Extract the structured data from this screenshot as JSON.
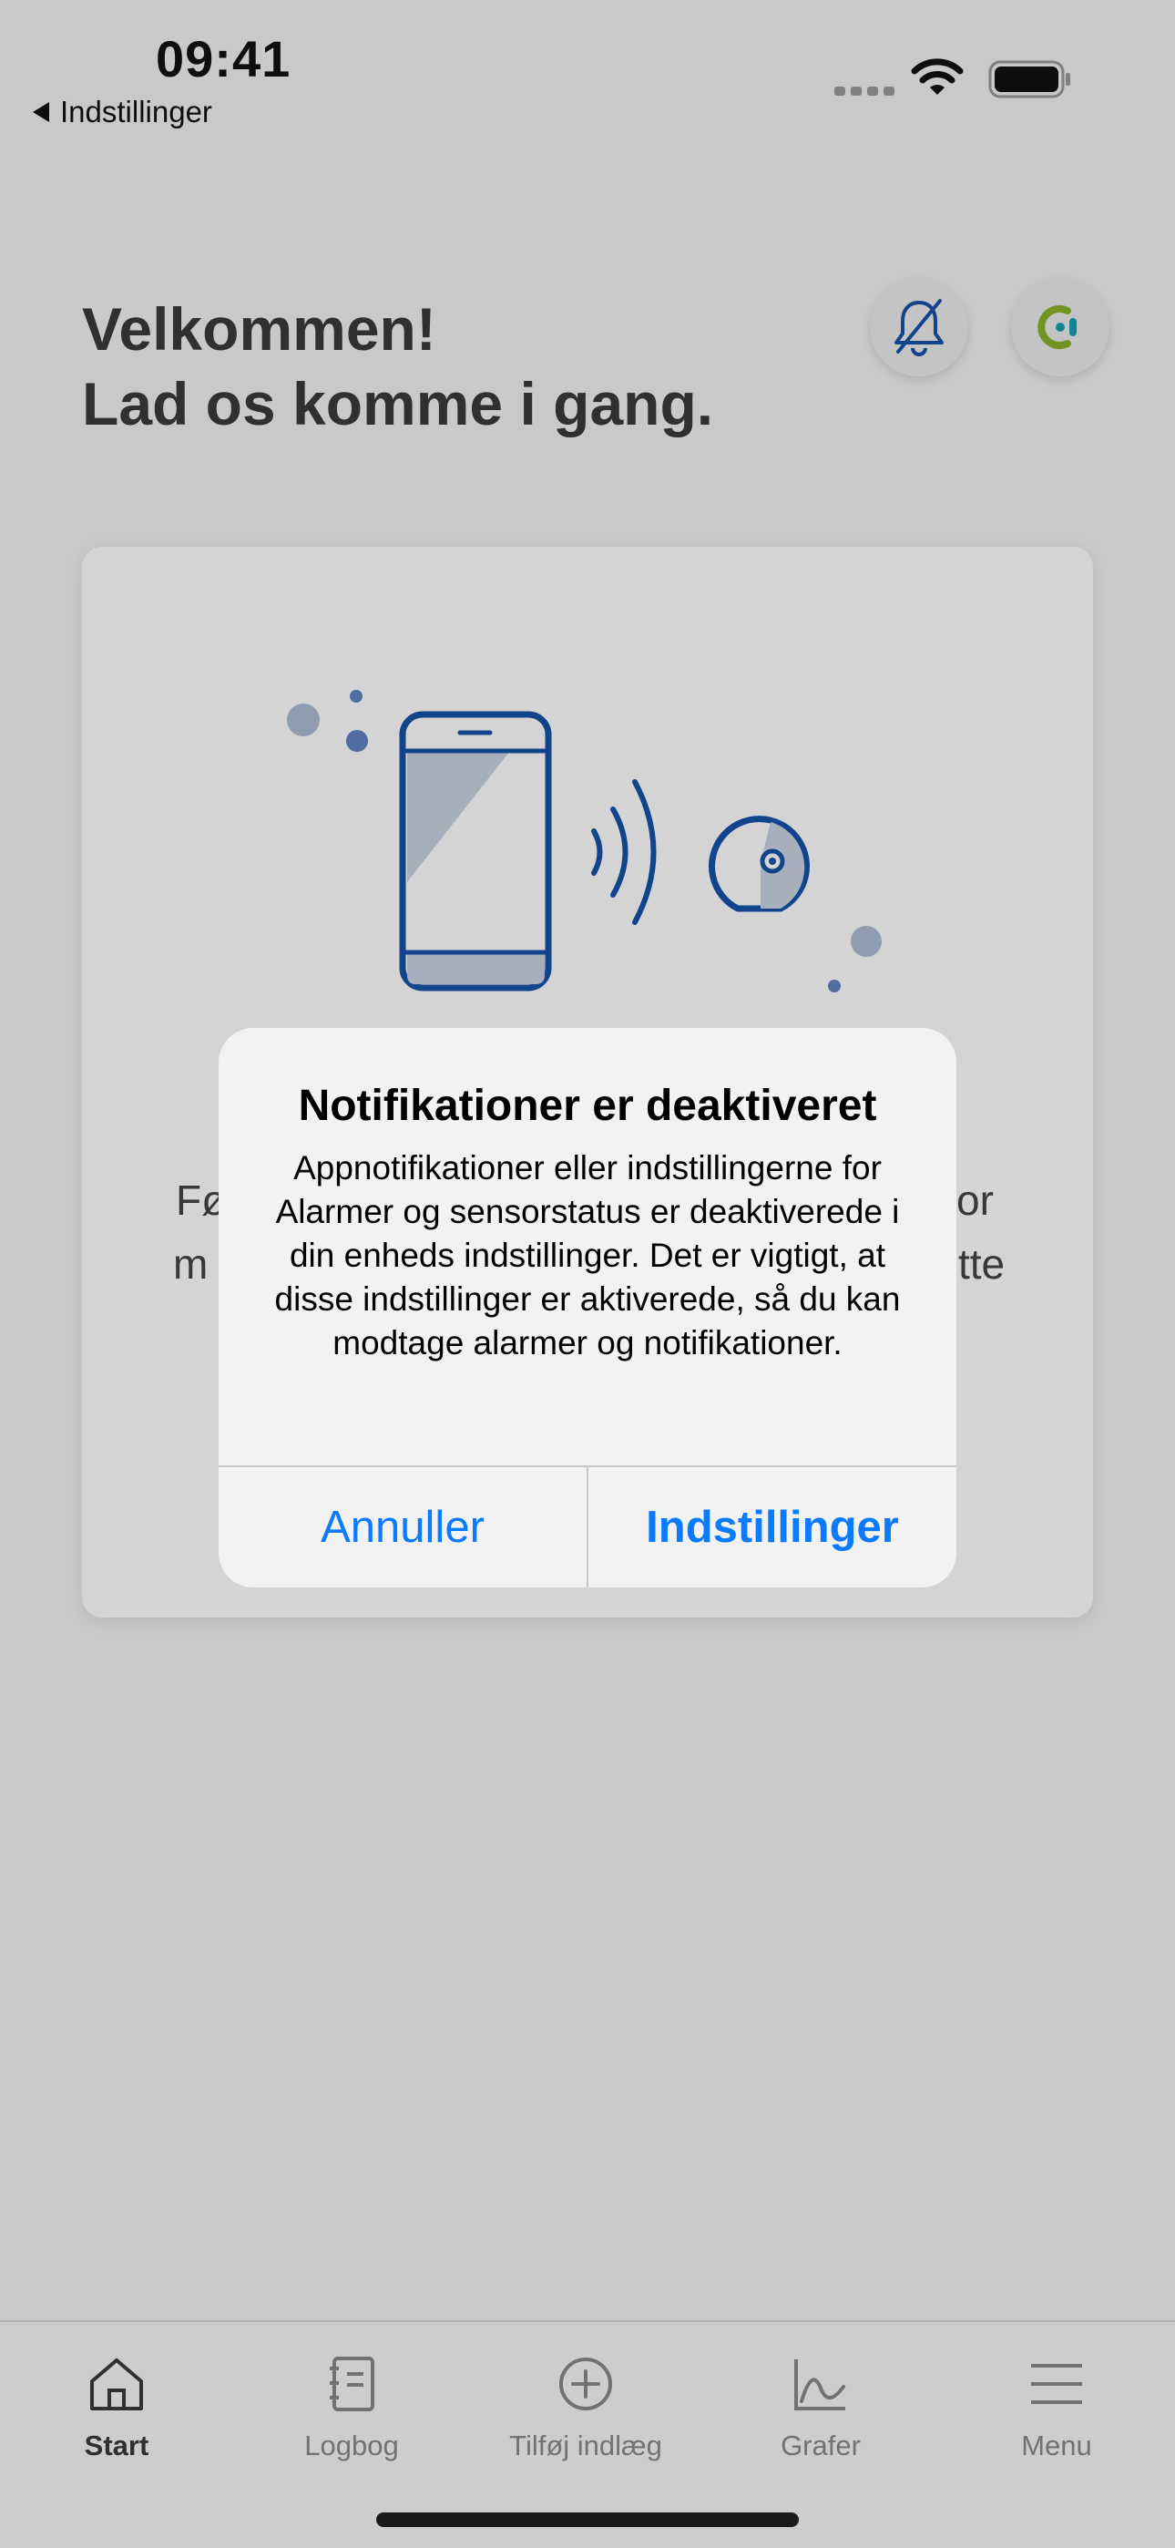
{
  "status_bar": {
    "time": "09:41",
    "back_label": "Indstillinger"
  },
  "header": {
    "title_line1": "Velkommen!",
    "title_line2": "Lad os komme i gang."
  },
  "card": {
    "text_line1_left": "Fø",
    "text_line1_right": "or",
    "text_line2_left": "m",
    "text_line2_right": "tte"
  },
  "alert": {
    "title": "Notifikationer er deaktiveret",
    "message": "Appnotifikationer eller indstillingerne for Alarmer og sensorstatus er deaktiverede i din enheds indstillinger. Det er vigtigt, at disse indstillinger er aktiverede, så du kan modtage alarmer og notifikationer.",
    "cancel_label": "Annuller",
    "settings_label": "Indstillinger"
  },
  "tabbar": {
    "items": [
      {
        "label": "Start",
        "icon": "home-icon"
      },
      {
        "label": "Logbog",
        "icon": "logbook-icon"
      },
      {
        "label": "Tilføj indlæg",
        "icon": "add-circle-icon"
      },
      {
        "label": "Grafer",
        "icon": "graph-icon"
      },
      {
        "label": "Menu",
        "icon": "menu-icon"
      }
    ]
  },
  "colors": {
    "accent": "#0a7aff",
    "illustration_blue": "#1652a8",
    "brand_green": "#8ab22a",
    "brand_teal": "#1aa1b5"
  }
}
